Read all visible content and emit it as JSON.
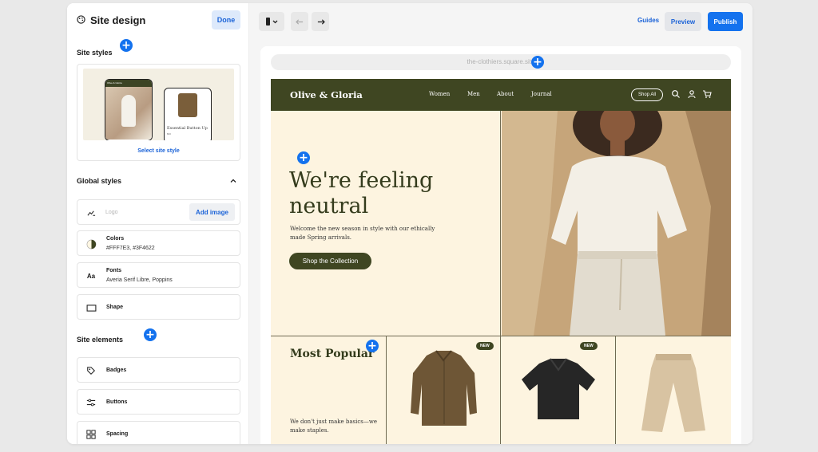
{
  "panel": {
    "title": "Site design",
    "done_label": "Done",
    "site_styles": {
      "heading": "Site styles",
      "select_label": "Select site style",
      "preview_brand": "Olive & Gloria",
      "preview_product_name": "Essential Button Up",
      "preview_product_price": "$60"
    },
    "global_styles": {
      "heading": "Global styles",
      "logo_placeholder": "Logo",
      "add_image_label": "Add image",
      "colors_label": "Colors",
      "colors_value": "#FFF7E3, #3F4622",
      "fonts_icon": "Aa",
      "fonts_label": "Fonts",
      "fonts_value": "Averia Serif Libre, Poppins",
      "shape_label": "Shape"
    },
    "site_elements": {
      "heading": "Site elements",
      "items": [
        {
          "label": "Badges",
          "icon": "tag-icon"
        },
        {
          "label": "Buttons",
          "icon": "sliders-icon"
        },
        {
          "label": "Spacing",
          "icon": "grid-icon"
        }
      ]
    }
  },
  "toolbar": {
    "device_icon": "mobile-icon",
    "guides_label": "Guides",
    "preview_label": "Preview",
    "publish_label": "Publish"
  },
  "canvas": {
    "url": "the-clothiers.square.site"
  },
  "site": {
    "brand": "Olive & Gloria",
    "nav": [
      "Women",
      "Men",
      "About",
      "Journal"
    ],
    "shop_all": "Shop All",
    "hero_title": "We're feeling neutral",
    "hero_subtitle": "Welcome the new season in style with our ethically made Spring arrivals.",
    "hero_cta": "Shop the Collection",
    "most_popular_title": "Most Popular",
    "most_popular_sub": "We don't just make basics—we make staples.",
    "badge_new": "NEW"
  },
  "colors": {
    "accent": "#1472EE",
    "brand_dark": "#3F4622",
    "brand_light": "#FFF7E3"
  }
}
